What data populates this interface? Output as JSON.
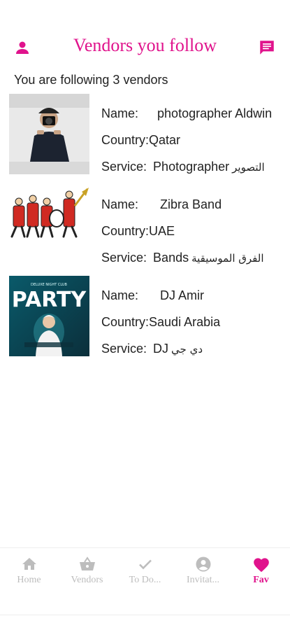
{
  "header": {
    "title": "Vendors you follow",
    "left_icon": "person-icon",
    "right_icon": "chat-icon"
  },
  "subtitle": "You are following 3 vendors",
  "vendors": [
    {
      "name_label": "Name:",
      "name": "photographer Aldwin",
      "country_label": "Country:",
      "country": "Qatar",
      "service_label": "Service:",
      "service": "Photographer",
      "service_ar": "التصوير"
    },
    {
      "name_label": "Name:",
      "name": "Zibra Band",
      "country_label": "Country:",
      "country": "UAE",
      "service_label": "Service:",
      "service": "Bands",
      "service_ar": "الفرق الموسيقية"
    },
    {
      "name_label": "Name:",
      "name": "DJ Amir",
      "country_label": "Country:",
      "country": "Saudi Arabia",
      "service_label": "Service:",
      "service": "DJ",
      "service_ar": "دي جي"
    }
  ],
  "party_poster": {
    "title": "PARTY",
    "header_text": "DELUXE NIGHT CLUB"
  },
  "nav": [
    {
      "label": "Home",
      "icon": "home-icon",
      "active": false
    },
    {
      "label": "Vendors",
      "icon": "basket-icon",
      "active": false
    },
    {
      "label": "To Do...",
      "icon": "check-icon",
      "active": false
    },
    {
      "label": "Invitat...",
      "icon": "account-icon",
      "active": false
    },
    {
      "label": "Fav",
      "icon": "heart-icon",
      "active": true
    }
  ],
  "colors": {
    "accent": "#e0138c",
    "inactive": "#bdbdbd"
  }
}
